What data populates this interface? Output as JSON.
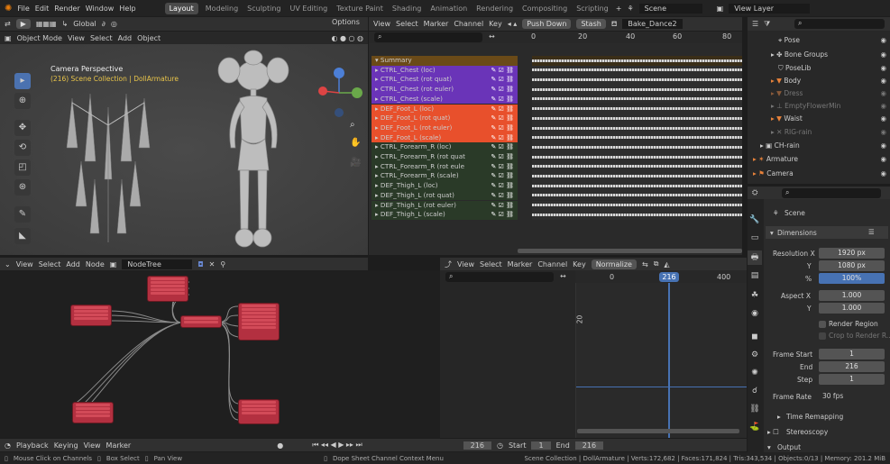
{
  "topbar": {
    "menus": [
      "File",
      "Edit",
      "Render",
      "Window",
      "Help"
    ],
    "workspace_tabs": [
      "Layout",
      "Modeling",
      "Sculpting",
      "UV Editing",
      "Texture Paint",
      "Shading",
      "Animation",
      "Rendering",
      "Compositing",
      "Scripting"
    ],
    "scene": "Scene",
    "view_layer": "View Layer"
  },
  "viewport": {
    "mode": "Object Mode",
    "menus": [
      "View",
      "Select",
      "Add",
      "Object"
    ],
    "transform": "Global",
    "options": "Options",
    "title": "Camera Perspective",
    "collection": "(216) Scene Collection | DollArmature"
  },
  "dopesheet": {
    "menus": [
      "View",
      "Select",
      "Marker",
      "Channel",
      "Key"
    ],
    "push_down": "Push Down",
    "stash": "Stash",
    "action": "Bake_Dance2",
    "ruler": [
      "0",
      "20",
      "40",
      "60",
      "80"
    ],
    "summary": "Summary",
    "channels": [
      "CTRL_Chest (loc)",
      "CTRL_Chest (rot quat)",
      "CTRL_Chest (rot euler)",
      "CTRL_Chest (scale)",
      "DEF_Foot_L (loc)",
      "DEF_Foot_L (rot quat)",
      "DEF_Foot_L (rot euler)",
      "DEF_Foot_L (scale)",
      "CTRL_Forearm_R (loc)",
      "CTRL_Forearm_R (rot quat",
      "CTRL_Forearm_R (rot eule",
      "CTRL_Forearm_R (scale)",
      "DEF_Thigh_L (loc)",
      "DEF_Thigh_L (rot quat)",
      "DEF_Thigh_L (rot euler)",
      "DEF_Thigh_L (scale)"
    ],
    "colors": {
      "purple": "#6a34b8",
      "orange": "#e8502c",
      "green": "#2a3a28",
      "summary": "#6a4a18"
    }
  },
  "outliner": {
    "items": [
      "Pose",
      "Bone Groups",
      "PoseLib",
      "Body",
      "Dress",
      "EmptyFlowerMin",
      "Waist",
      "RIG-rain",
      "CH-rain",
      "Armature",
      "Camera"
    ]
  },
  "nodes": {
    "menus": [
      "View",
      "Select",
      "Add",
      "Node"
    ],
    "tree": "NodeTree"
  },
  "graph": {
    "menus": [
      "View",
      "Select",
      "Marker",
      "Channel",
      "Key"
    ],
    "normalize": "Normalize",
    "ruler": [
      "0",
      "216",
      "400"
    ],
    "yval": "20",
    "current_frame": "216"
  },
  "properties": {
    "scene": "Scene",
    "dimensions": "Dimensions",
    "res_x_label": "Resolution X",
    "res_x": "1920 px",
    "res_y_label": "Y",
    "res_y": "1080 px",
    "pct_label": "%",
    "pct": "100%",
    "aspect_x_label": "Aspect X",
    "aspect_x": "1.000",
    "aspect_y_label": "Y",
    "aspect_y": "1.000",
    "render_region": "Render Region",
    "crop": "Crop to Render R...",
    "frame_start_label": "Frame Start",
    "frame_start": "1",
    "end_label": "End",
    "end": "216",
    "step_label": "Step",
    "step": "1",
    "frame_rate_label": "Frame Rate",
    "frame_rate": "30 fps",
    "time_remap": "Time Remapping",
    "stereo": "Stereoscopy",
    "output": "Output"
  },
  "timeline": {
    "menus": [
      "Playback",
      "Keying",
      "View",
      "Marker"
    ],
    "current": "216",
    "start_label": "Start",
    "start": "1",
    "end_label": "End",
    "end": "216"
  },
  "statusbar": {
    "hint1": "Mouse Click on Channels",
    "hint2": "Box Select",
    "hint3": "Pan View",
    "hint4": "Dope Sheet Channel Context Menu",
    "stats": "Scene Collection | DollArmature | Verts:172,682 | Faces:171,824 | Tris:343,534 | Objects:0/13 | Memory: 201.2 MiB"
  }
}
